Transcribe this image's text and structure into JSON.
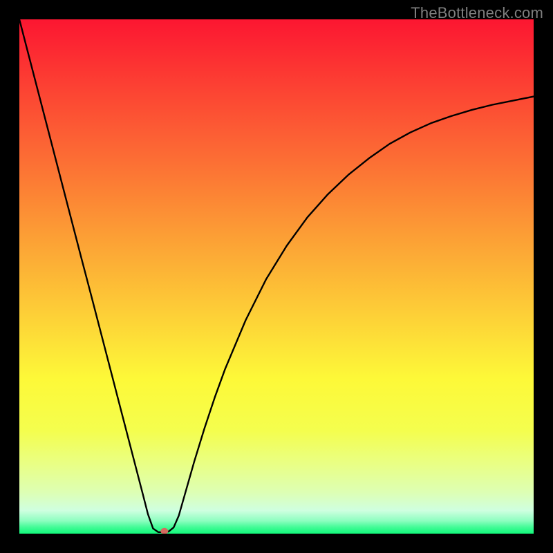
{
  "attribution": {
    "watermark": "TheBottleneck.com"
  },
  "chart_data": {
    "type": "line",
    "title": "",
    "xlabel": "",
    "ylabel": "",
    "xlim": [
      0,
      100
    ],
    "ylim": [
      0,
      100
    ],
    "grid": false,
    "legend": false,
    "background_gradient": {
      "direction": "vertical",
      "stops": [
        {
          "pos": 0.0,
          "color": "#fc1631"
        },
        {
          "pos": 0.14,
          "color": "#fc4433"
        },
        {
          "pos": 0.28,
          "color": "#fc7034"
        },
        {
          "pos": 0.42,
          "color": "#fc9e35"
        },
        {
          "pos": 0.56,
          "color": "#fdcb37"
        },
        {
          "pos": 0.7,
          "color": "#fdf938"
        },
        {
          "pos": 0.8,
          "color": "#f4fe4e"
        },
        {
          "pos": 0.86,
          "color": "#eaff81"
        },
        {
          "pos": 0.92,
          "color": "#ddffb4"
        },
        {
          "pos": 0.955,
          "color": "#cfffe0"
        },
        {
          "pos": 0.975,
          "color": "#8dfec0"
        },
        {
          "pos": 0.988,
          "color": "#40fb95"
        },
        {
          "pos": 1.0,
          "color": "#12f97a"
        }
      ]
    },
    "series": [
      {
        "name": "bottleneck-curve",
        "color": "#000000",
        "x": [
          0.0,
          2.0,
          4.0,
          6.0,
          8.0,
          10.0,
          12.0,
          14.0,
          16.0,
          18.0,
          20.0,
          22.0,
          24.0,
          25.0,
          26.0,
          27.0,
          28.0,
          29.0,
          30.0,
          31.0,
          32.0,
          34.0,
          36.0,
          38.0,
          40.0,
          44.0,
          48.0,
          52.0,
          56.0,
          60.0,
          64.0,
          68.0,
          72.0,
          76.0,
          80.0,
          84.0,
          88.0,
          92.0,
          96.0,
          100.0
        ],
        "y": [
          100.0,
          92.3,
          84.6,
          76.9,
          69.2,
          61.5,
          53.8,
          46.2,
          38.5,
          30.8,
          23.1,
          15.4,
          7.7,
          3.8,
          1.0,
          0.3,
          0.3,
          0.4,
          1.2,
          3.5,
          7.0,
          14.0,
          20.5,
          26.5,
          32.0,
          41.5,
          49.5,
          56.0,
          61.5,
          66.0,
          69.8,
          73.0,
          75.8,
          78.0,
          79.8,
          81.2,
          82.4,
          83.4,
          84.2,
          85.0
        ]
      }
    ],
    "marker": {
      "name": "optimal-point",
      "x": 28.2,
      "y": 0.5,
      "color": "#d46a5f",
      "rx": 5.5,
      "ry": 4.5
    }
  }
}
